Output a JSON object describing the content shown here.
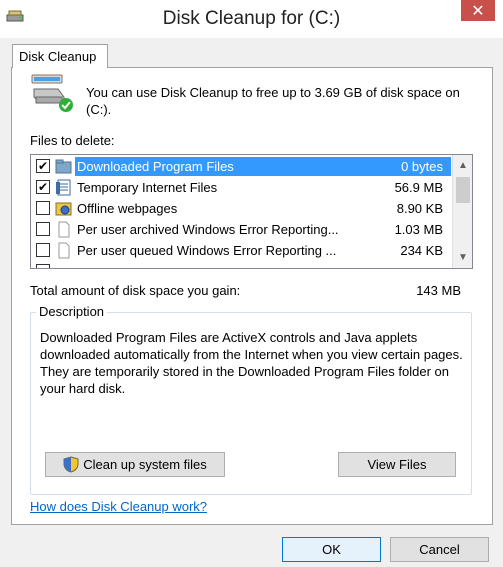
{
  "window": {
    "title": "Disk Cleanup for  (C:)",
    "close_glyph": "✕"
  },
  "tab": {
    "label": "Disk Cleanup"
  },
  "intro_text": "You can use Disk Cleanup to free up to 3.69 GB of disk space on (C:).",
  "files_label": "Files to delete:",
  "files": [
    {
      "name": "Downloaded Program Files",
      "size": "0 bytes",
      "checked": true,
      "selected": true,
      "icon": "folder-icon"
    },
    {
      "name": "Temporary Internet Files",
      "size": "56.9 MB",
      "checked": true,
      "selected": false,
      "icon": "document-icon"
    },
    {
      "name": "Offline webpages",
      "size": "8.90 KB",
      "checked": false,
      "selected": false,
      "icon": "offline-pages-icon"
    },
    {
      "name": "Per user archived Windows Error Reporting...",
      "size": "1.03 MB",
      "checked": false,
      "selected": false,
      "icon": "blank-file-icon"
    },
    {
      "name": "Per user queued Windows Error Reporting ...",
      "size": "234 KB",
      "checked": false,
      "selected": false,
      "icon": "blank-file-icon"
    }
  ],
  "scroll": {
    "up_glyph": "▲",
    "down_glyph": "▼"
  },
  "total": {
    "label": "Total amount of disk space you gain:",
    "value": "143 MB"
  },
  "description": {
    "title": "Description",
    "text": "Downloaded Program Files are ActiveX controls and Java applets downloaded automatically from the Internet when you view certain pages. They are temporarily stored in the Downloaded Program Files folder on your hard disk."
  },
  "buttons": {
    "cleanup_system": "Clean up system files",
    "view_files": "View Files",
    "ok": "OK",
    "cancel": "Cancel"
  },
  "help_link": "How does Disk Cleanup work?",
  "colors": {
    "selection": "#3399ff",
    "close": "#c7504b",
    "link": "#0066cc"
  }
}
